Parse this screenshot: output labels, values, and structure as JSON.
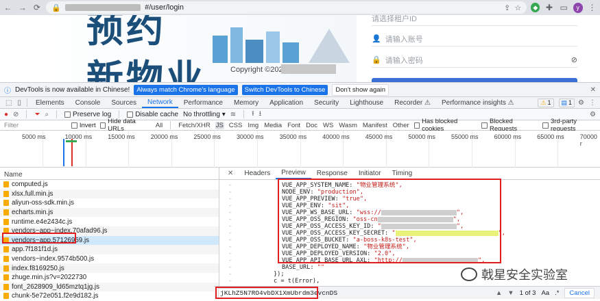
{
  "browser": {
    "url_suffix": "#/user/login",
    "profile_letter": "y"
  },
  "page": {
    "hero_chars": [
      "预约",
      "新物业"
    ],
    "copyright": "Copyright ©2022",
    "fields": [
      {
        "placeholder": "请选择租户ID"
      },
      {
        "placeholder": "请输入账号"
      },
      {
        "placeholder": "请输入密码"
      }
    ]
  },
  "notice": {
    "text": "DevTools is now available in Chinese!",
    "btn_match": "Always match Chrome's language",
    "btn_switch": "Switch DevTools to Chinese",
    "btn_dont": "Don't show again"
  },
  "devtools": {
    "tabs": [
      "Elements",
      "Console",
      "Sources",
      "Network",
      "Performance",
      "Memory",
      "Application",
      "Security",
      "Lighthouse",
      "Recorder ⚠",
      "Performance insights ⚠"
    ],
    "active_tab": "Network",
    "warn_count": "1",
    "msg_count": "1"
  },
  "network_toolbar": {
    "preserve_log": "Preserve log",
    "disable_cache": "Disable cache",
    "throttling": "No throttling"
  },
  "filter": {
    "placeholder": "Filter",
    "invert": "Invert",
    "hide_data": "Hide data URLs",
    "types": [
      "All",
      "Fetch/XHR",
      "JS",
      "CSS",
      "Img",
      "Media",
      "Font",
      "Doc",
      "WS",
      "Wasm",
      "Manifest",
      "Other"
    ],
    "active_type": "JS",
    "blocked_cookies": "Has blocked cookies",
    "blocked_requests": "Blocked Requests",
    "third_party": "3rd-party requests"
  },
  "timeline": {
    "ticks": [
      "5000 ms",
      "10000 ms",
      "15000 ms",
      "20000 ms",
      "25000 ms",
      "30000 ms",
      "35000 ms",
      "40000 ms",
      "45000 ms",
      "50000 ms",
      "55000 ms",
      "60000 ms",
      "65000 ms",
      "70000 r"
    ]
  },
  "requests": {
    "header": "Name",
    "rows": [
      "computed.js",
      "xlsx.full.min.js",
      "aliyun-oss-sdk.min.js",
      "echarts.min.js",
      "runtime.e4e2434c.js",
      "vendors~app~index.70afad96.js",
      "vendors~app.57126959.js",
      "app.7f181f1d.js",
      "vendors~index.9574b500.js",
      "index.f8169250.js",
      "zhuge.min.js?v=2022730",
      "font_2628909_ld65mztq1jg.js",
      "chunk-5e72e051.f2e9d182.js"
    ],
    "selected": "vendors~app.57126959.js"
  },
  "preview": {
    "tabs": [
      "Headers",
      "Preview",
      "Response",
      "Initiator",
      "Timing"
    ],
    "active": "Preview",
    "lines": [
      {
        "k": "VUE_APP_SYSTEM_NAME: ",
        "v": "\"物业管理系统\","
      },
      {
        "k": "NODE_ENV: ",
        "v": "\"production\","
      },
      {
        "k": "VUE_APP_PREVIEW: ",
        "v": "\"true\","
      },
      {
        "k": "VUE_APP_ENV: ",
        "v": "\"sit\","
      },
      {
        "k": "VUE_APP_WS_BASE_URL: ",
        "v": "\"wss://",
        "blur": "grey"
      },
      {
        "k": "VUE_APP_OSS_REGION: ",
        "v": "\"oss-cn",
        "blur": "grey"
      },
      {
        "k": "VUE_APP_OSS_ACCESS_KEY_ID: ",
        "v": "\"",
        "blur": "grey"
      },
      {
        "k": "VUE_APP_OSS_ACCESS_KEY_SECRET: ",
        "v": "\"",
        "blur": "yellow"
      },
      {
        "k": "VUE_APP_OSS_BUCKET: ",
        "v": "\"a-boss-k8s-test\","
      },
      {
        "k": "VUE_APP_DEPLOYED_NAME: ",
        "v": "\"物业管理系统\","
      },
      {
        "k": "VUE_APP_DEPLOYED_VERSION: ",
        "v": "\"2.0\","
      },
      {
        "k": "VUE_APP_API_BASE_URL_AXL: ",
        "v": "\"http://",
        "blur": "grey"
      },
      {
        "k": "BASE_URL: ",
        "v": "\"\""
      }
    ],
    "after": [
      "});",
      "c = t(Error),"
    ]
  },
  "search": {
    "value": "jKLhZ5N7RO4vbDX1XmUbrdm3evcnDS",
    "matches": "1 of 3",
    "case": "Aa",
    "regex": ".*",
    "cancel": "Cancel"
  },
  "watermark": "戟星安全实验室"
}
